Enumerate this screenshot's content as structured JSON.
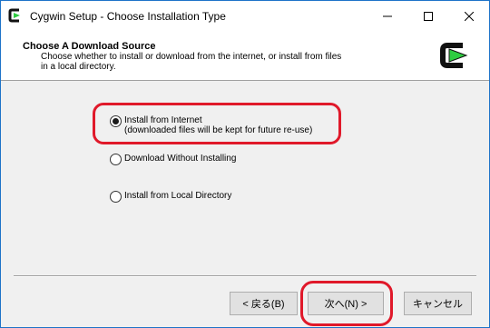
{
  "window": {
    "title": "Cygwin Setup - Choose Installation Type",
    "controls": [
      "minimize-icon",
      "maximize-icon",
      "close-icon"
    ]
  },
  "header": {
    "title": "Choose  A Download Source",
    "description_line1": "Choose whether to install or download from the internet, or install from files",
    "description_line2": "in a local directory.",
    "logo_icon": "cygwin-logo-icon"
  },
  "options": [
    {
      "label": "Install from Internet",
      "sublabel": "(downloaded files will be kept for future re-use)",
      "selected": true
    },
    {
      "label": "Download Without Installing",
      "selected": false
    },
    {
      "label": "Install from Local Directory",
      "selected": false
    }
  ],
  "buttons": {
    "back": "< 戻る(B)",
    "next": "次へ(N) >",
    "cancel": "キャンセル"
  },
  "colors": {
    "highlight": "#e0192a",
    "window_border": "#1e73c8",
    "logo_green": "#2ecc40"
  }
}
